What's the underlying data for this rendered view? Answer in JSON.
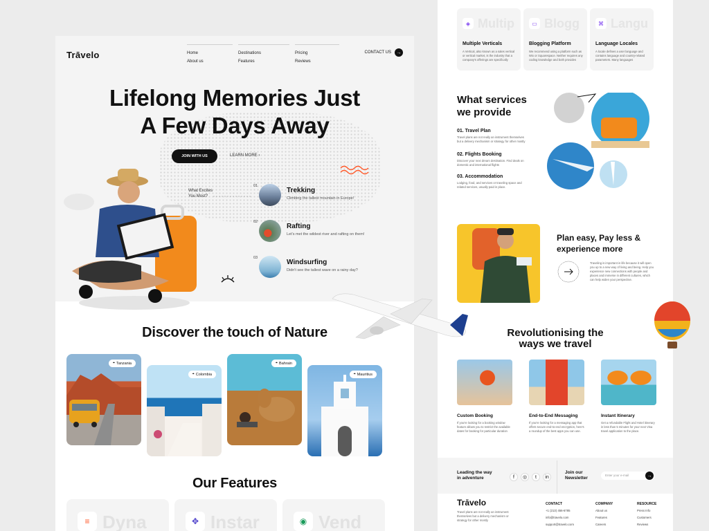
{
  "left": {
    "nav": {
      "logo": "Trāvelo",
      "col1": [
        "Home",
        "About us"
      ],
      "col2": [
        "Destinations",
        "Features"
      ],
      "col3": [
        "Pricing",
        "Reviews"
      ],
      "contact": "CONTACT US"
    },
    "hero": {
      "title_line1": "Lifelong Memories Just",
      "title_line2": "A Few Days Away",
      "join": "JOIN WITH US",
      "more": "LEARN MORE",
      "excites_line1": "What Excites",
      "excites_line2": "You Most?"
    },
    "activities": [
      {
        "num": "01",
        "title": "Trekking",
        "desc": "Climbing the tallest mountain in Europe!"
      },
      {
        "num": "02",
        "title": "Rafting",
        "desc": "Let's met the wildest river and rafting on them!"
      },
      {
        "num": "03",
        "title": "Windsurfing",
        "desc": "Didn't see the tallest wave on a rainy day?"
      }
    ],
    "discover_title": "Discover the touch of Nature",
    "destinations": [
      "Tanzania",
      "Colombia",
      "Bahrain",
      "Mauritius"
    ],
    "features_title": "Our Features",
    "features_ghost": [
      "Dyna",
      "Instar",
      "Vend"
    ]
  },
  "right": {
    "verticals": [
      {
        "ghost": "Multip",
        "title": "Multiple Verticals",
        "desc": "A Vertical, also known as a sales vertical or vertical market, is the industry that a company's offerings are specifically"
      },
      {
        "ghost": "Blogg",
        "title": "Blogging Platform",
        "desc": "We recommend using a platform such as Wix or Squarespace. Neither requires any coding knowledge and both provides"
      },
      {
        "ghost": "Langu",
        "title": "Language Locales",
        "desc": "A locale defines a user language and contains language and country-related parameters. Many languages"
      }
    ],
    "services_title_line1": "What services",
    "services_title_line2": "we provide",
    "services": [
      {
        "title": "01. Travel Plan",
        "desc": "Travel plans are not really an instrument themselves but a delivery mechanism or strategy for other mostly"
      },
      {
        "title": "02. Flights Booking",
        "desc": "Discover your next dream destination. Find deals on domestic and international flights"
      },
      {
        "title": "03. Accommodation",
        "desc": "Lodging, food, and services or traveling space and related services, usually paid in place."
      }
    ],
    "plan_title_line1": "Plan easy, Pay less &",
    "plan_title_line2": "experience more",
    "plan_desc": "Traveling is important in life because it will open you up to a new way of living and being. Help you experience new connections with people and places and immerse in different cultures, which can help widen your perspective.",
    "rev_title_line1": "Revolutionising the",
    "rev_title_line2": "ways we travel",
    "rev_items": [
      {
        "title": "Custom Booking",
        "desc": "If you're looking for a booking window feature allows you to restrict the available dates for booking for particular duration"
      },
      {
        "title": "End-to-End Messaging",
        "desc": "If you're looking for a messaging app that offers secure end-to-end encryption, here's a roundup of the best apps you can use."
      },
      {
        "title": "Instant Itinerary",
        "desc": "Get a refundable Flight and Hotel itinerary in less than 5 minutes for your next Visa travel application to the place."
      }
    ],
    "footer": {
      "leading_line1": "Leading the way",
      "leading_line2": "in adventure",
      "join_line1": "Join our",
      "join_line2": "Newsletter",
      "email_placeholder": "Enter your e-mail",
      "logo": "Trāvelo",
      "about": "Travel plans are not really an instrument themselves but a delivery mechanism or strategy for other mostly",
      "contact": {
        "h": "CONTACT",
        "items": [
          "+1 (213) 456-6785",
          "info@travelo.com",
          "support@travelo.com"
        ]
      },
      "company": {
        "h": "COMPANY",
        "items": [
          "About us",
          "Features",
          "Careers"
        ]
      },
      "resource": {
        "h": "RESOURCE",
        "items": [
          "Press Info",
          "Customers",
          "Reviews"
        ]
      }
    }
  },
  "colors": {
    "accent": "#ff5a2b",
    "dark": "#111111",
    "yellow": "#f7c52b"
  }
}
